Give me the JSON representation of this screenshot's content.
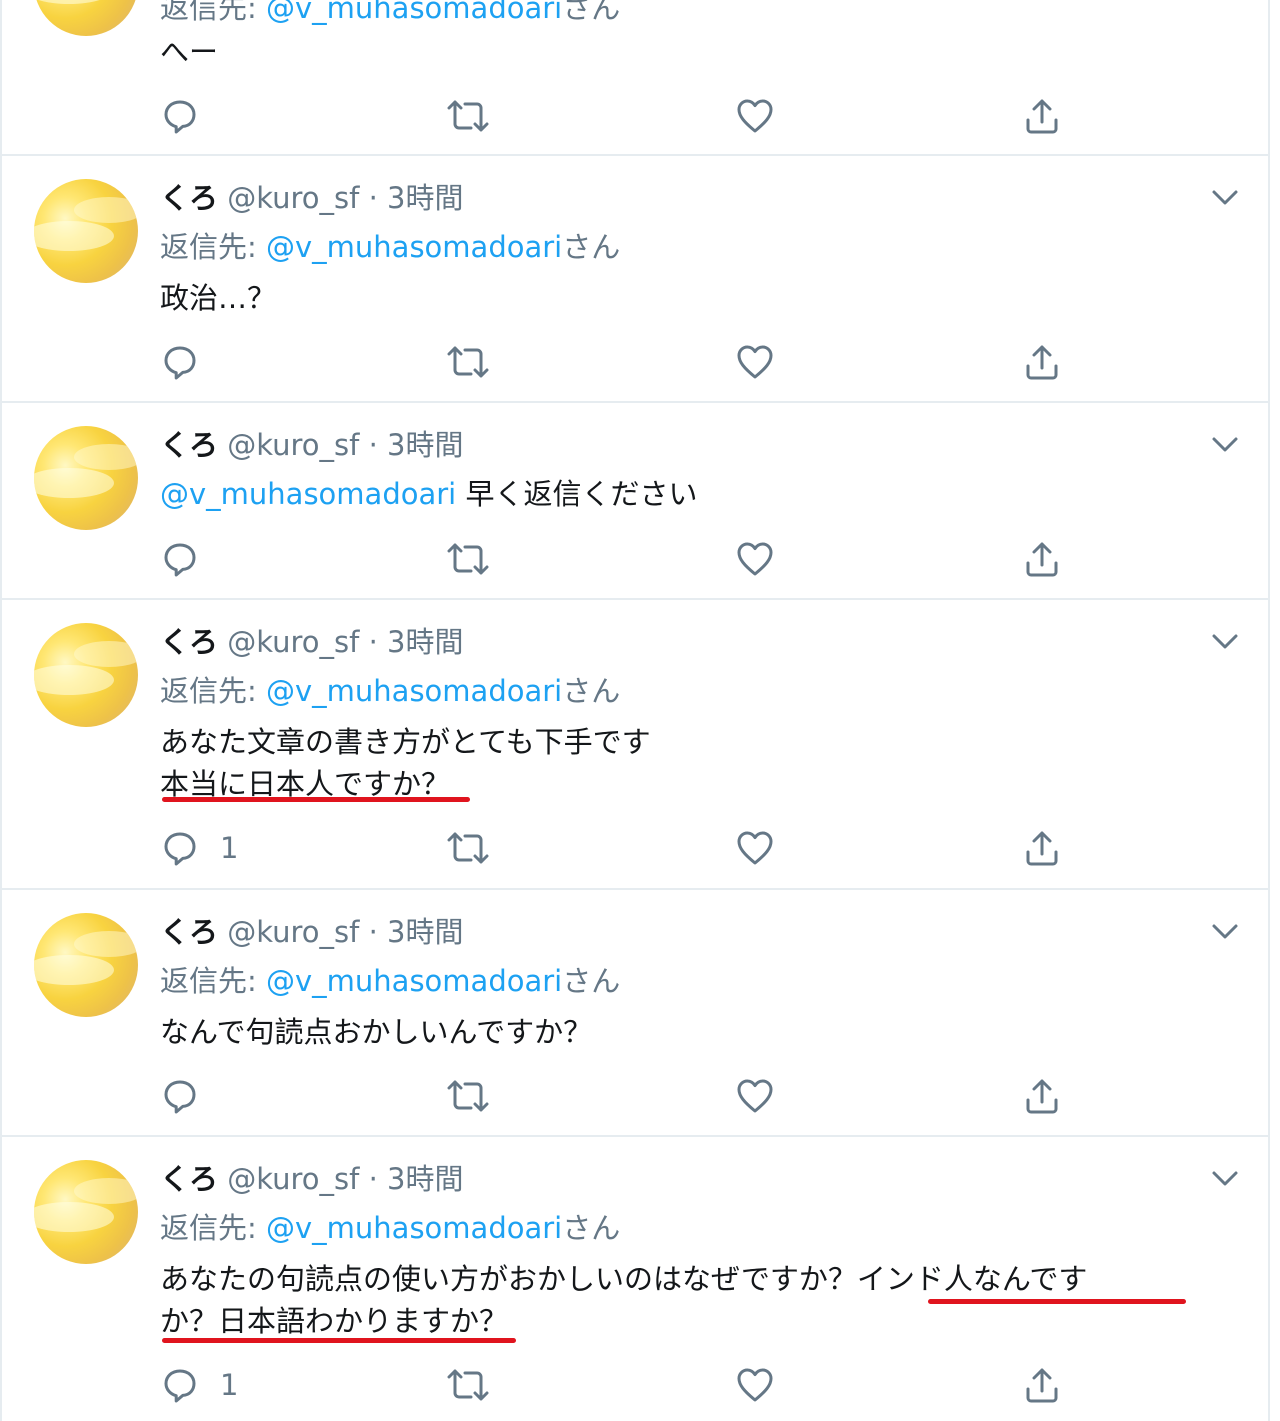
{
  "tweets": [
    {
      "name": "",
      "handle": "",
      "time": "",
      "reply_prefix": "返信先:",
      "reply_to": "@v_muhasomadoari",
      "reply_suffix": "さん",
      "lines": [
        "へー"
      ],
      "reply_count": ""
    },
    {
      "name": "くろ",
      "handle": "@kuro_sf",
      "time": "3時間",
      "reply_prefix": "返信先:",
      "reply_to": "@v_muhasomadoari",
      "reply_suffix": "さん",
      "lines": [
        "政治…？"
      ],
      "reply_count": ""
    },
    {
      "name": "くろ",
      "handle": "@kuro_sf",
      "time": "3時間",
      "mention": "@v_muhasomadoari",
      "lines": [
        "早く返信ください"
      ],
      "reply_count": ""
    },
    {
      "name": "くろ",
      "handle": "@kuro_sf",
      "time": "3時間",
      "reply_prefix": "返信先:",
      "reply_to": "@v_muhasomadoari",
      "reply_suffix": "さん",
      "lines": [
        "あなた文章の書き方がとても下手です",
        "本当に日本人ですか？"
      ],
      "reply_count": "1"
    },
    {
      "name": "くろ",
      "handle": "@kuro_sf",
      "time": "3時間",
      "reply_prefix": "返信先:",
      "reply_to": "@v_muhasomadoari",
      "reply_suffix": "さん",
      "lines": [
        "なんで句読点おかしいんですか？"
      ],
      "reply_count": ""
    },
    {
      "name": "くろ",
      "handle": "@kuro_sf",
      "time": "3時間",
      "reply_prefix": "返信先:",
      "reply_to": "@v_muhasomadoari",
      "reply_suffix": "さん",
      "lines": [
        "あなたの句読点の使い方がおかしいのはなぜですか？インド人なんです",
        "か？日本語わかりますか？"
      ],
      "reply_count": "1"
    }
  ],
  "separator": " · ",
  "icons": {
    "reply": "reply-icon",
    "retweet": "retweet-icon",
    "like": "heart-icon",
    "share": "share-icon",
    "more": "chevron-down-icon"
  },
  "colors": {
    "link": "#1da1f2",
    "secondary": "#657786",
    "highlight_underline": "#e0141e"
  }
}
